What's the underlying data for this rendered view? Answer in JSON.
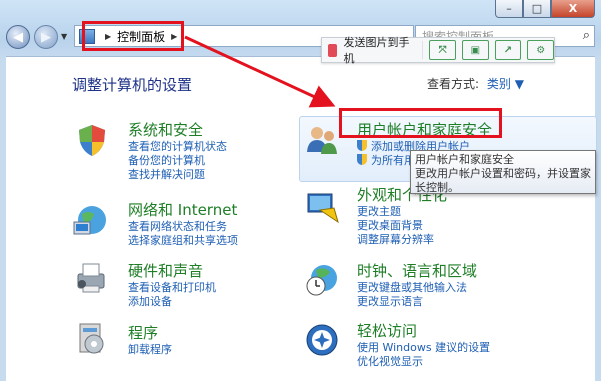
{
  "window": {
    "minimize_label": "–",
    "maximize_label": "□",
    "close_label": "X"
  },
  "nav": {
    "back_glyph": "◀",
    "forward_glyph": "▶",
    "breadcrumb": "控制面板",
    "search_placeholder": "搜索控制面板"
  },
  "toolbar": {
    "send_label": "发送图片到手机"
  },
  "heading": "调整计算机的设置",
  "view": {
    "label": "查看方式:",
    "value": "类别 ▼"
  },
  "categories_left": [
    {
      "title": "系统和安全",
      "links": [
        "查看您的计算机状态",
        "备份您的计算机",
        "查找并解决问题"
      ]
    },
    {
      "title": "网络和 Internet",
      "links": [
        "查看网络状态和任务",
        "选择家庭组和共享选项"
      ]
    },
    {
      "title": "硬件和声音",
      "links": [
        "查看设备和打印机",
        "添加设备"
      ]
    },
    {
      "title": "程序",
      "links": [
        "卸载程序"
      ]
    }
  ],
  "categories_right": [
    {
      "title": "用户帐户和家庭安全",
      "links": [
        "添加或删除用户帐户",
        "为所有用户设置家长控制"
      ]
    },
    {
      "title": "外观和个性化",
      "links": [
        "更改主题",
        "更改桌面背景",
        "调整屏幕分辨率"
      ]
    },
    {
      "title": "时钟、语言和区域",
      "links": [
        "更改键盘或其他输入法",
        "更改显示语言"
      ]
    },
    {
      "title": "轻松访问",
      "links": [
        "使用 Windows 建议的设置",
        "优化视觉显示"
      ]
    }
  ],
  "tooltip": {
    "line1": "用户帐户和家庭安全",
    "line2": "更改用户帐户设置和密码，并设置家",
    "line3": "长控制。"
  }
}
